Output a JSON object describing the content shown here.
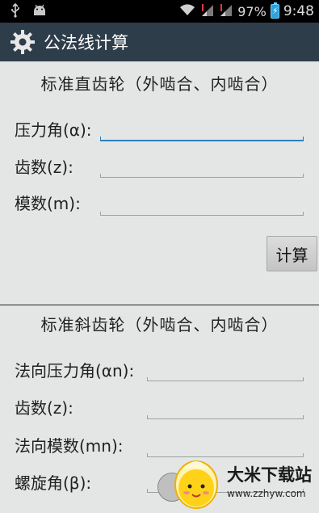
{
  "status_bar": {
    "left_icons": [
      "usb-icon",
      "android-icon"
    ],
    "battery_percent": "97%",
    "time": "9:48"
  },
  "action_bar": {
    "title": "公法线计算"
  },
  "spur_section": {
    "title": "标准直齿轮（外啮合、内啮合）",
    "pressure_angle_label": "压力角(α):",
    "teeth_label": "齿数(z):",
    "module_label": "模数(m):",
    "calc_button": "计算"
  },
  "helical_section": {
    "title": "标准斜齿轮（外啮合、内啮合）",
    "normal_pressure_angle_label": "法向压力角(αn):",
    "teeth_label": "齿数(z):",
    "normal_module_label": "法向模数(mn):",
    "helix_angle_label": "螺旋角(β):"
  },
  "watermark": {
    "title": "大米下载站",
    "url": "www.zzhyw.com"
  }
}
